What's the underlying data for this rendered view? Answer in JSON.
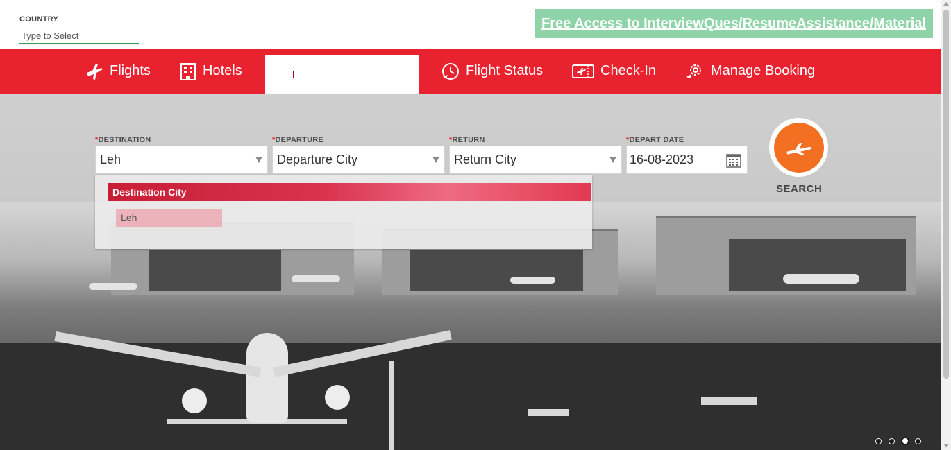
{
  "header": {
    "country_label": "COUNTRY",
    "country_placeholder": "Type to Select",
    "promo_text": "Free Access to InterviewQues/ResumeAssistance/Material"
  },
  "nav": {
    "flights": "Flights",
    "hotels": "Hotels",
    "flight_status": "Flight Status",
    "check_in": "Check-In",
    "manage_booking": "Manage Booking"
  },
  "form": {
    "required_mark": "*",
    "destination_label": "DESTINATION",
    "destination_value": "Leh",
    "departure_label": "DEPARTURE",
    "departure_value": "Departure City",
    "return_label": "RETURN",
    "return_value": "Return City",
    "depart_date_label": "DEPART DATE",
    "depart_date_value": "16-08-2023",
    "search_label": "SEARCH"
  },
  "dropdown": {
    "header": "Destination City",
    "options": [
      "Leh"
    ]
  },
  "carousel": {
    "dot_count": 4,
    "active_index": 2
  },
  "colors": {
    "nav_red": "#e8222f",
    "promo_green": "#8fd4a8",
    "search_orange": "#f37022"
  }
}
